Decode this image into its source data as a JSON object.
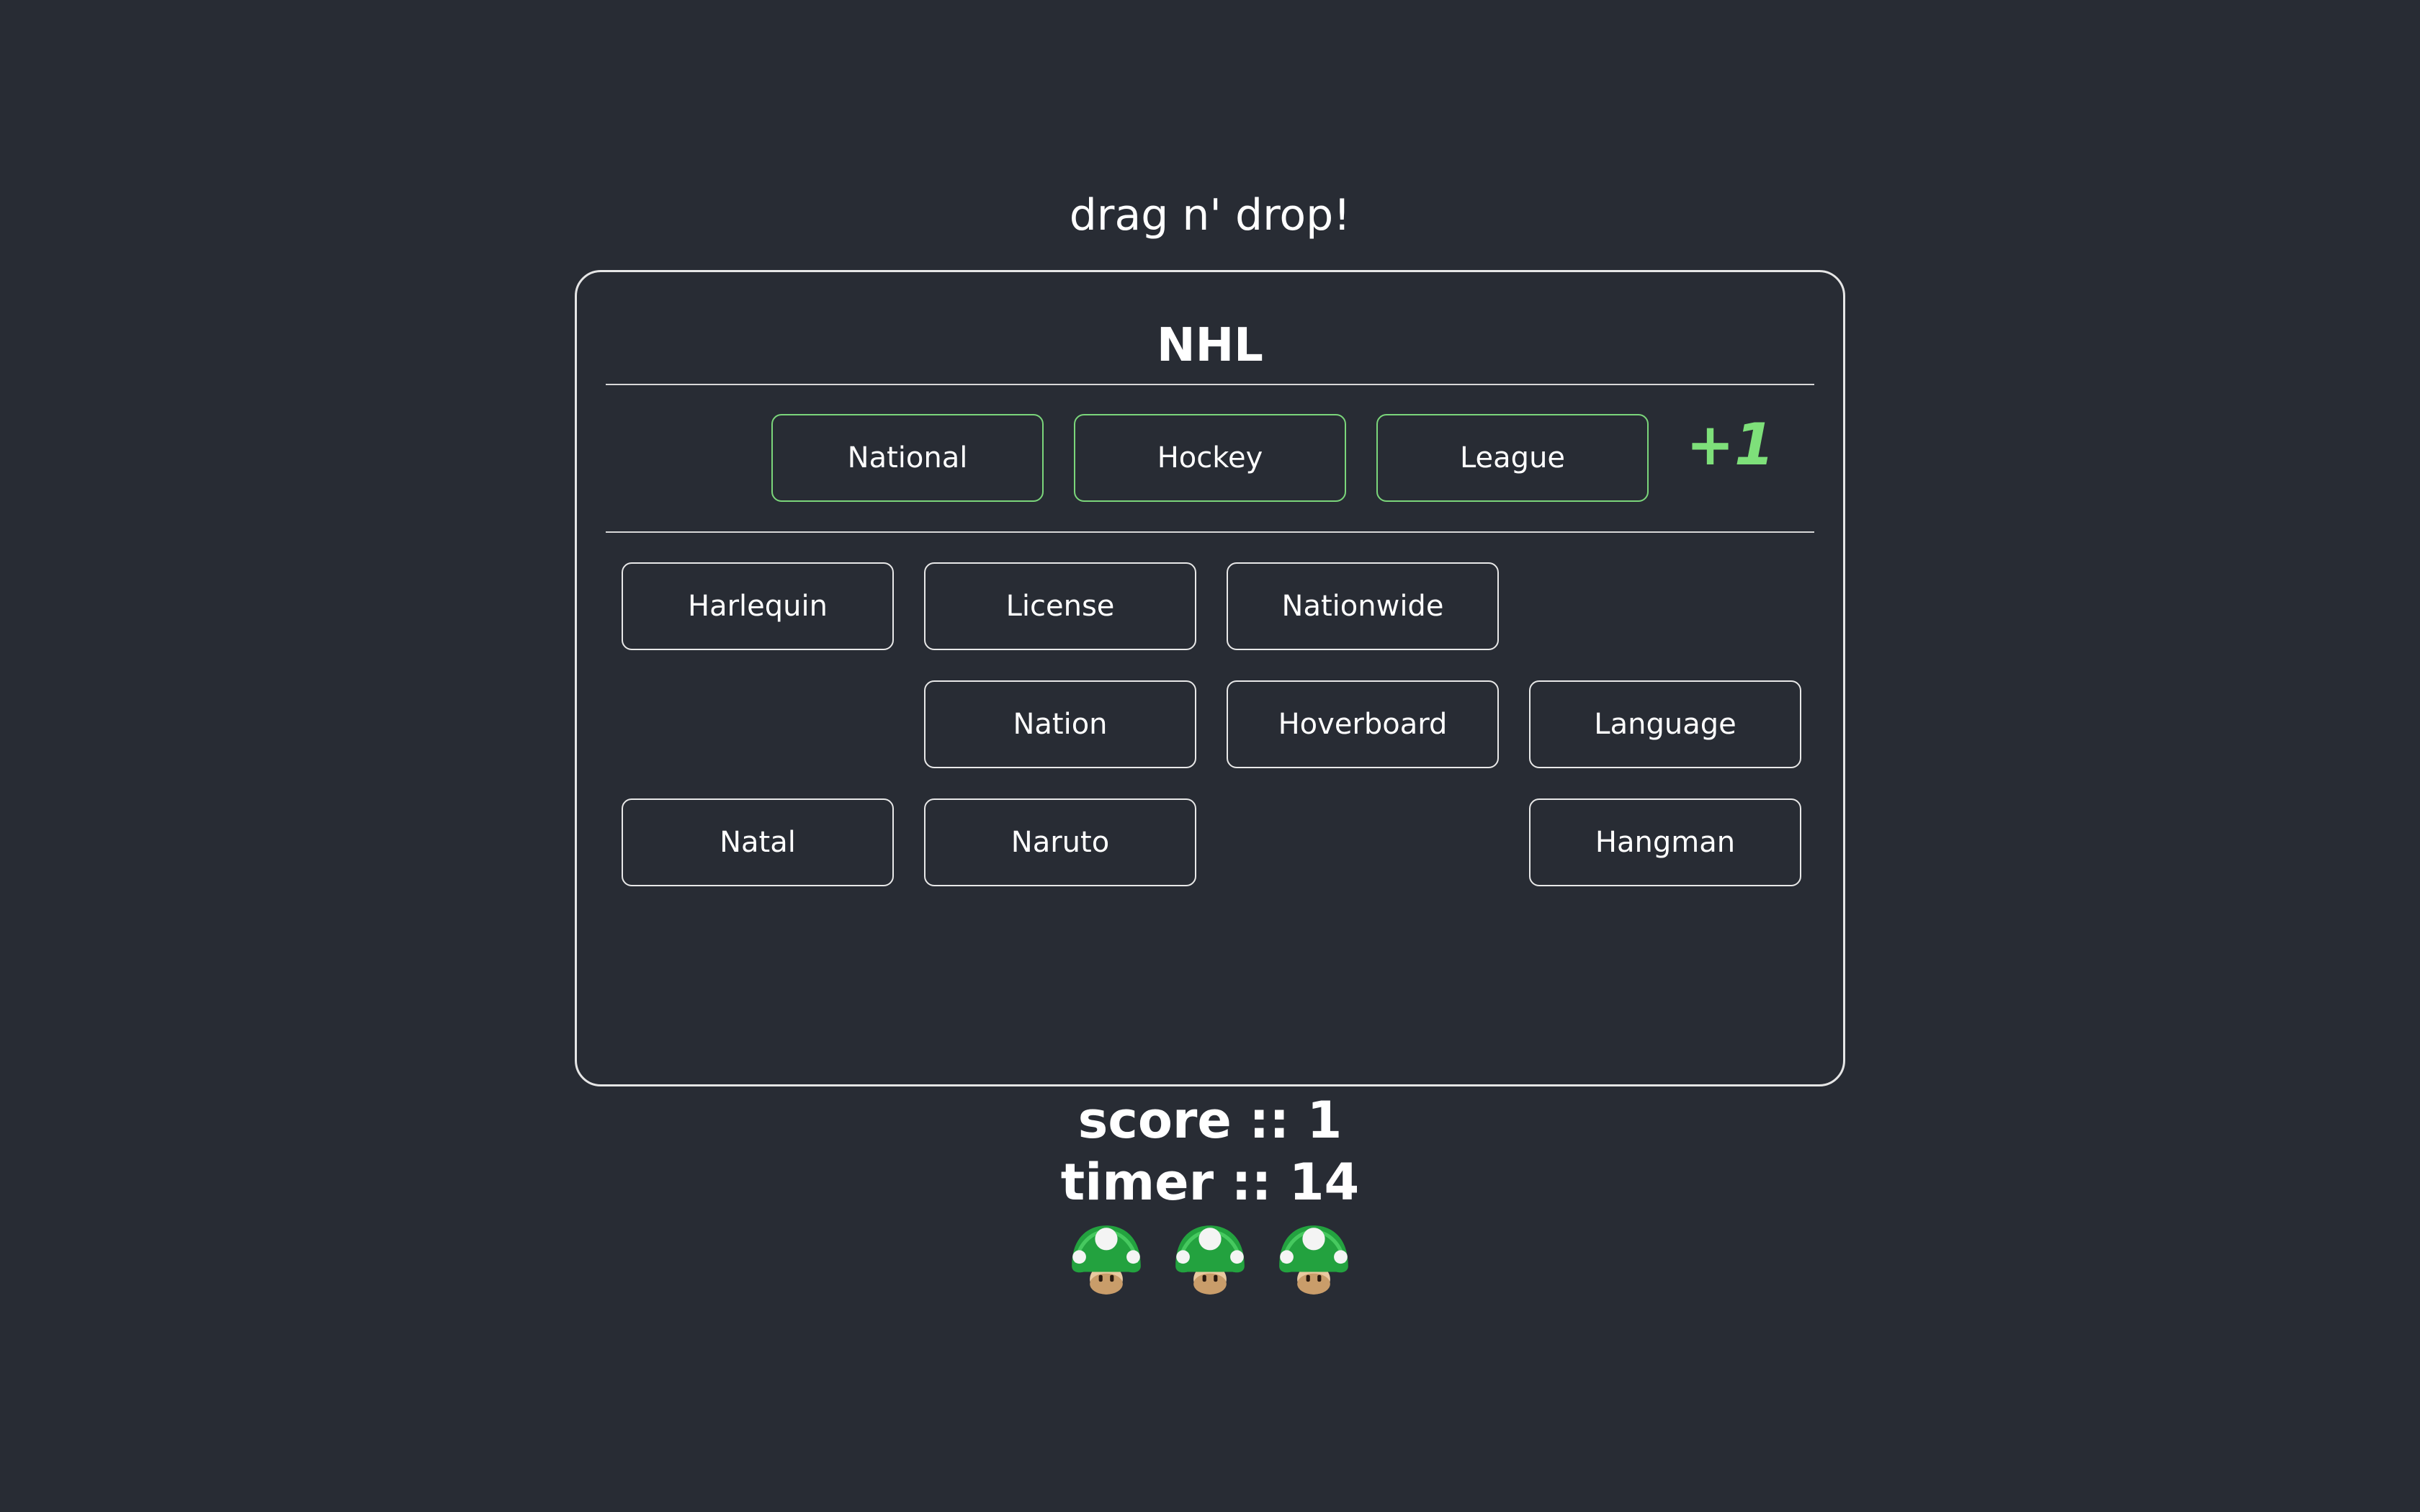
{
  "header": {
    "title": "drag n' drop!"
  },
  "puzzle": {
    "acronym": "NHL"
  },
  "answers": [
    {
      "label": "National"
    },
    {
      "label": "Hockey"
    },
    {
      "label": "League"
    }
  ],
  "feedback": {
    "points_text": "+1"
  },
  "pool": [
    {
      "label": "Harlequin"
    },
    {
      "label": "License"
    },
    {
      "label": "Nationwide"
    },
    {
      "label": "Nation"
    },
    {
      "label": "Hoverboard"
    },
    {
      "label": "Language"
    },
    {
      "label": "Natal"
    },
    {
      "label": "Naruto"
    },
    {
      "label": "Hangman"
    }
  ],
  "stats": {
    "score_text": "score :: 1",
    "timer_text": "timer :: 14"
  },
  "lives": {
    "count": 3,
    "icon": "one-up-mushroom-icon"
  },
  "colors": {
    "background": "#282c34",
    "correct_border": "#7bd67b",
    "bonus_text": "#7ee07a",
    "mushroom_cap": "#2db84a"
  }
}
